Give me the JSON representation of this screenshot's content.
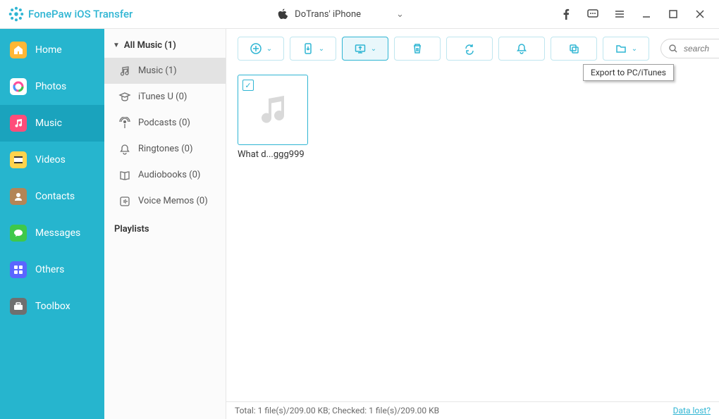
{
  "brand": "FonePaw iOS Transfer",
  "device": "DoTrans' iPhone",
  "sidebar": {
    "items": [
      {
        "label": "Home",
        "bg": "#ffb735"
      },
      {
        "label": "Photos",
        "bg": "#4498ff"
      },
      {
        "label": "Music",
        "bg": "#ff4d7a"
      },
      {
        "label": "Videos",
        "bg": "#ffd34c"
      },
      {
        "label": "Contacts",
        "bg": "#b38557"
      },
      {
        "label": "Messages",
        "bg": "#3ec84a"
      },
      {
        "label": "Others",
        "bg": "#5a66ff"
      },
      {
        "label": "Toolbox",
        "bg": "#6f6f6f"
      }
    ]
  },
  "subpanel": {
    "heading": "All Music (1)",
    "items": [
      {
        "label": "Music (1)"
      },
      {
        "label": "iTunes U (0)"
      },
      {
        "label": "Podcasts (0)"
      },
      {
        "label": "Ringtones (0)"
      },
      {
        "label": "Audiobooks (0)"
      },
      {
        "label": "Voice Memos (0)"
      }
    ],
    "section": "Playlists"
  },
  "toolbar": {
    "tooltip": "Export to PC/iTunes"
  },
  "search": {
    "placeholder": "search"
  },
  "tiles": [
    {
      "label": "What d...ggg999",
      "checked": true
    }
  ],
  "status": {
    "text": "Total: 1 file(s)/209.00 KB; Checked: 1 file(s)/209.00 KB",
    "datalost": "Data lost?"
  }
}
